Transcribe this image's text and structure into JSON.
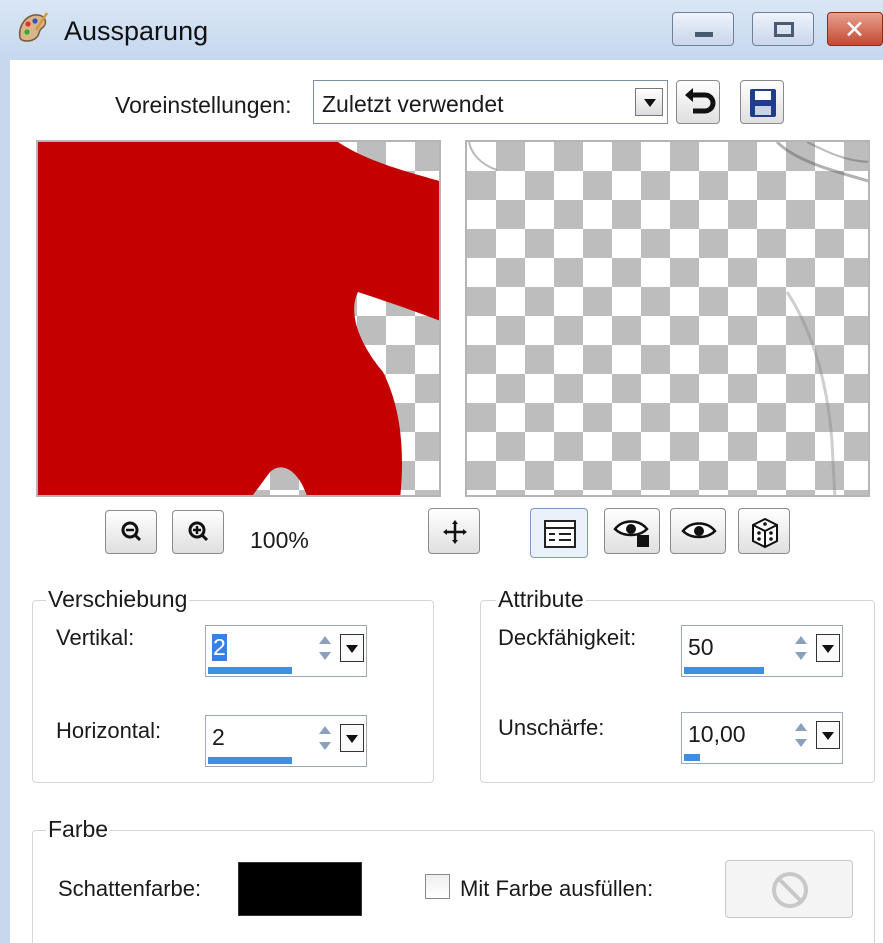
{
  "window": {
    "title": "Aussparung",
    "icon": "paint-palette-icon",
    "controls": [
      "minimize-icon",
      "maximize-icon",
      "close-icon"
    ]
  },
  "presets": {
    "label": "Voreinstellungen:",
    "selected": "Zuletzt verwendet",
    "reset_icon": "reset-arrow-icon",
    "save_icon": "floppy-disk-icon"
  },
  "preview": {
    "zoom": "100%",
    "zoom_out_icon": "zoom-out-icon",
    "zoom_in_icon": "zoom-in-icon",
    "pan_icon": "move-icon",
    "toolbar_icons": [
      "properties-icon",
      "proof-icon",
      "auto-proof-icon",
      "randomize-icon"
    ]
  },
  "offset": {
    "title": "Verschiebung",
    "vertical_label": "Vertikal:",
    "vertical_value": "2",
    "horizontal_label": "Horizontal:",
    "horizontal_value": "2"
  },
  "attributes": {
    "title": "Attribute",
    "opacity_label": "Deckfähigkeit:",
    "opacity_value": "50",
    "blur_label": "Unschärfe:",
    "blur_value": "10,00"
  },
  "color": {
    "title": "Farbe",
    "shadow_color_label": "Schattenfarbe:",
    "shadow_color": "#000000",
    "fill_label": "Mit Farbe ausfüllen:",
    "fill_checked": false
  },
  "colors": {
    "titlebar": "#c6d7ee",
    "preview_shape": "#c40000",
    "slider_bar": "#3d8fe4"
  }
}
